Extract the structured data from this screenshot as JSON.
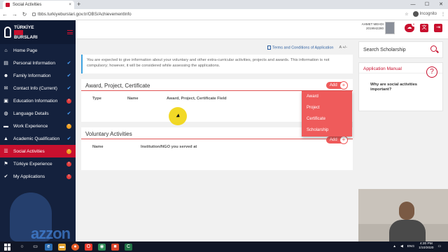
{
  "browser": {
    "tab_title": "Social Activities",
    "tab_close": "×",
    "new_tab": "+",
    "url": "tbbs.turkiyeburslari.gov.tr/OBS/AchievementInfo",
    "incognito_label": "Incognito",
    "window_controls": [
      "—",
      "☐",
      "✕"
    ]
  },
  "logo": {
    "line1": "TÜRKİYE",
    "line2": "BURSLARI"
  },
  "sidebar": {
    "items": [
      {
        "label": "Home Page",
        "icon": "home-icon",
        "glyph": "⌂",
        "status": ""
      },
      {
        "label": "Personal Information",
        "icon": "id-card-icon",
        "glyph": "▤",
        "status": "check"
      },
      {
        "label": "Family Information",
        "icon": "family-icon",
        "glyph": "☻",
        "status": "check"
      },
      {
        "label": "Contact Info (Current)",
        "icon": "contact-icon",
        "glyph": "✉",
        "status": "check"
      },
      {
        "label": "Education Information",
        "icon": "education-icon",
        "glyph": "▣",
        "status": "red"
      },
      {
        "label": "Language Details",
        "icon": "globe-icon",
        "glyph": "◍",
        "status": "check"
      },
      {
        "label": "Work Experience",
        "icon": "briefcase-icon",
        "glyph": "▬",
        "status": "orange"
      },
      {
        "label": "Academic Qualification",
        "icon": "graduation-cap-icon",
        "glyph": "▲",
        "status": "check"
      },
      {
        "label": "Social Activities",
        "icon": "social-icon",
        "glyph": "☰",
        "status": "orange"
      },
      {
        "label": "Türkiye Experience",
        "icon": "turkey-flag-icon",
        "glyph": "⚑",
        "status": "red"
      },
      {
        "label": "My Applications",
        "icon": "shield-check-icon",
        "glyph": "✔",
        "status": "red"
      }
    ]
  },
  "header": {
    "user_name": "AHMET MEHDI",
    "user_id": "2019942280",
    "cloud_badge": "0"
  },
  "main": {
    "terms_link": "Terms and Conditions of Application",
    "font_size_control": "A +/-",
    "info_text": "You are expected to give information about your voluntary and other extra-curricular activities, projects and awards. This information is not compulsory; however, it will be considered while assessing the applications.",
    "award_card": {
      "title": "Award, Project, Certificate",
      "add_label": "Add",
      "columns": [
        "Type",
        "Name",
        "Award, Project, Certificate Field"
      ]
    },
    "voluntary_card": {
      "title": "Voluntary Activities",
      "add_label": "Add",
      "columns": [
        "Name",
        "Institution/NGO you served at"
      ]
    },
    "dropdown": [
      "Award",
      "Project",
      "Certificate",
      "Scholarship"
    ]
  },
  "right": {
    "search_label": "Search Scholarship",
    "manual_title": "Application Manual",
    "manual_question": "Why are social activities important?"
  },
  "watermark": "azzon",
  "taskbar": {
    "lang": "ENG",
    "time": "4:20 PM",
    "date": "1/10/2020"
  },
  "colors": {
    "brand_red": "#c8102e",
    "sidebar_bg": "#14213d",
    "accent_salmon": "#ef5b5b"
  }
}
